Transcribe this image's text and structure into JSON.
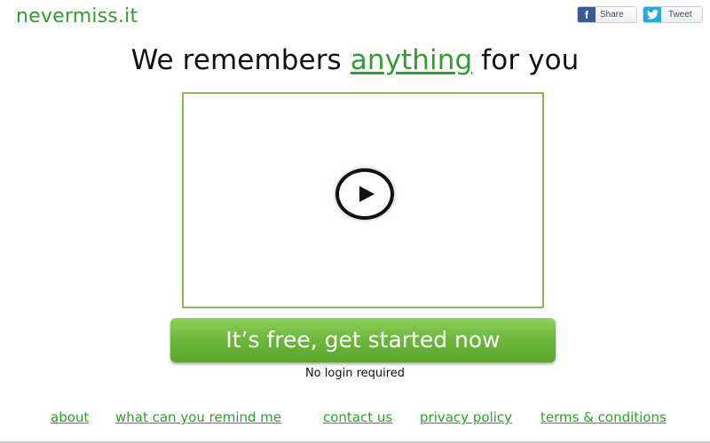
{
  "brand": {
    "logo_text": "nevermiss.it",
    "accent_color": "#2f9e2f"
  },
  "social": {
    "facebook": {
      "icon": "facebook-icon",
      "label": "Share",
      "icon_glyph": "f"
    },
    "twitter": {
      "icon": "twitter-bird-icon",
      "label": "Tweet"
    }
  },
  "headline": {
    "before": "We remembers ",
    "highlight": "anything",
    "after": " for you"
  },
  "video": {
    "play_icon": "play-icon",
    "border_color": "#8fb55d"
  },
  "cta": {
    "label": "It’s free, get started now",
    "note": "No login required"
  },
  "footer": {
    "links": [
      {
        "label": "about"
      },
      {
        "label": "what can you remind me"
      },
      {
        "label": "contact us"
      },
      {
        "label": "privacy policy"
      },
      {
        "label": "terms & conditions"
      }
    ]
  }
}
